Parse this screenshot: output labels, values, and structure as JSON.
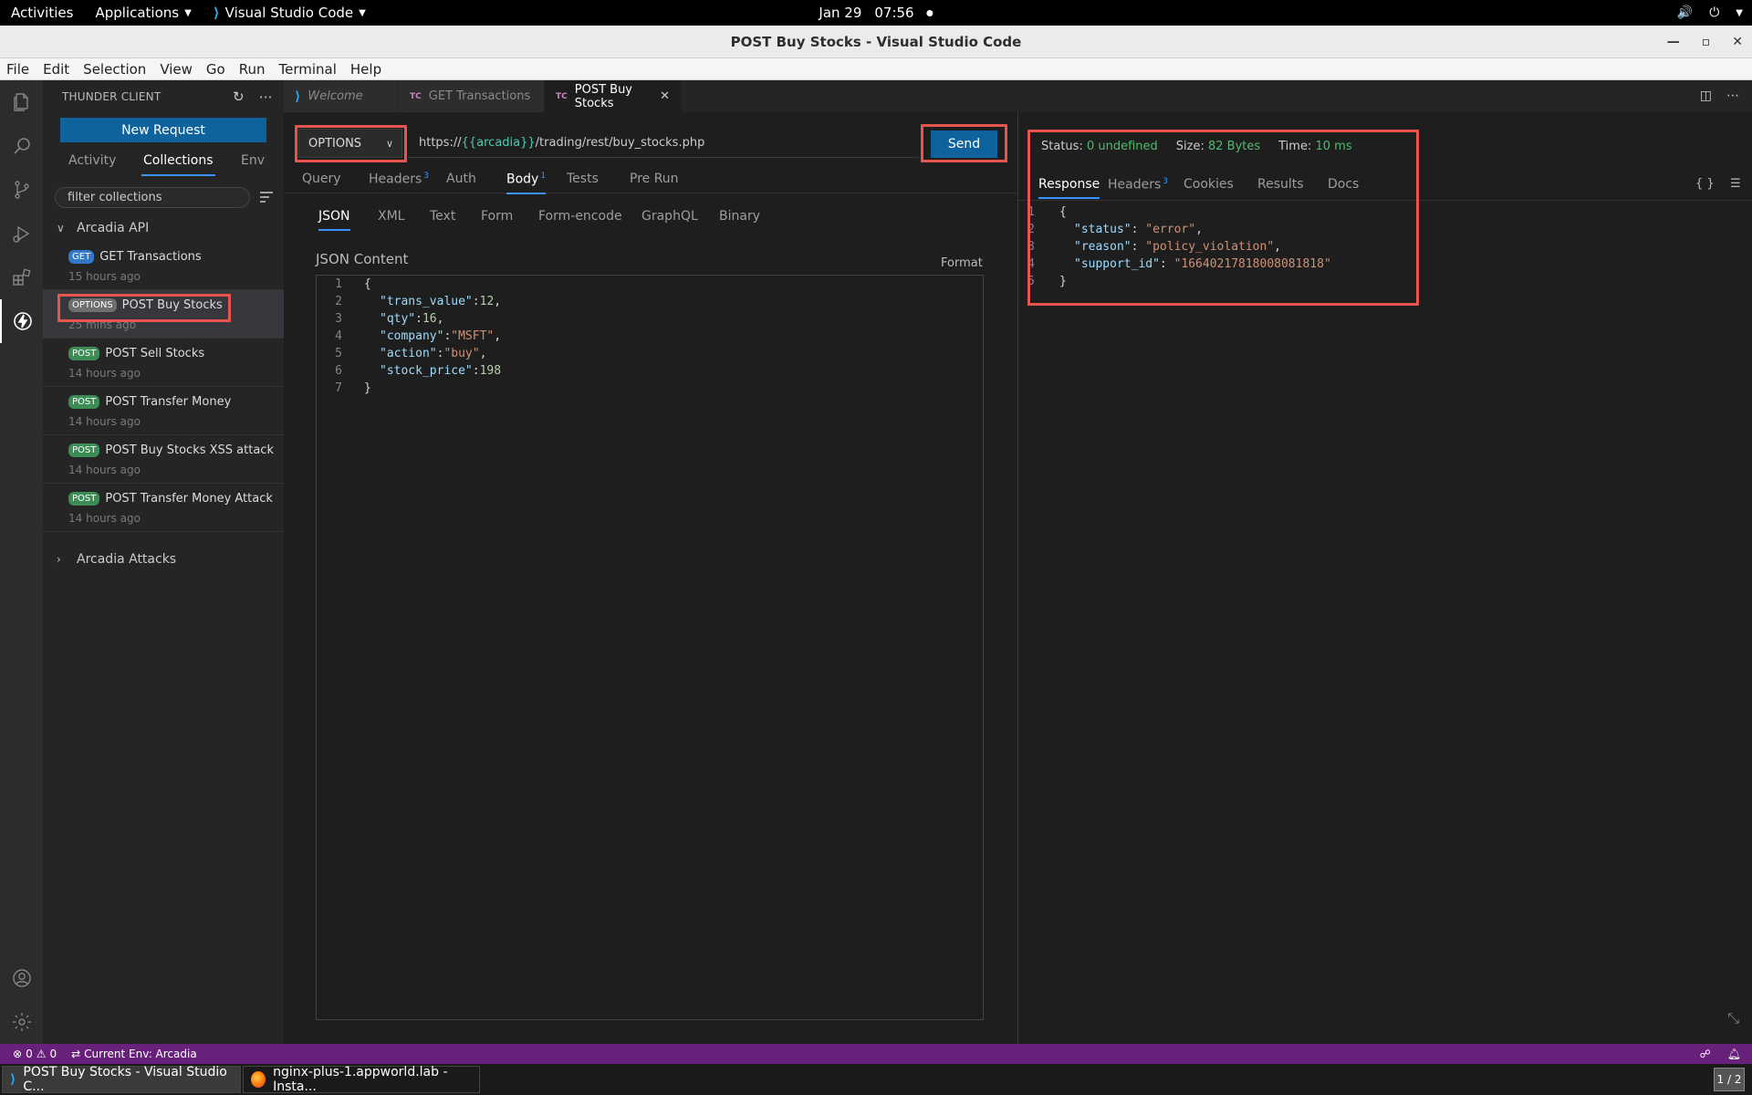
{
  "topbar": {
    "activities": "Activities",
    "applications": "Applications",
    "app_name": "Visual Studio Code",
    "date": "Jan 29",
    "time": "07:56"
  },
  "window": {
    "title": "POST Buy Stocks - Visual Studio Code"
  },
  "menu": [
    "File",
    "Edit",
    "Selection",
    "View",
    "Go",
    "Run",
    "Terminal",
    "Help"
  ],
  "sidebar": {
    "title": "THUNDER CLIENT",
    "new_request": "New Request",
    "tabs": [
      "Activity",
      "Collections",
      "Env"
    ],
    "active_tab": "Collections",
    "filter_placeholder": "filter collections",
    "collection": "Arcadia API",
    "requests": [
      {
        "method": "GET",
        "name": "GET Transactions",
        "time": "15 hours ago"
      },
      {
        "method": "OPTIONS",
        "name": "POST Buy Stocks",
        "time": "25 mins ago"
      },
      {
        "method": "POST",
        "name": "POST Sell Stocks",
        "time": "14 hours ago"
      },
      {
        "method": "POST",
        "name": "POST Transfer Money",
        "time": "14 hours ago"
      },
      {
        "method": "POST",
        "name": "POST Buy Stocks XSS attack",
        "time": "14 hours ago"
      },
      {
        "method": "POST",
        "name": "POST Transfer Money Attack",
        "time": "14 hours ago"
      }
    ],
    "collection2": "Arcadia Attacks"
  },
  "tabs": [
    {
      "label": "Welcome",
      "icon": "vscode-icon"
    },
    {
      "label": "GET Transactions",
      "icon": "TC"
    },
    {
      "label": "POST Buy Stocks",
      "icon": "TC"
    }
  ],
  "request": {
    "method": "OPTIONS",
    "url_prefix": "https://",
    "url_var": "{{arcadia}}",
    "url_path": "/trading/rest/buy_stocks.php",
    "send": "Send",
    "tabs": {
      "query": "Query",
      "headers": "Headers",
      "headers_count": "3",
      "auth": "Auth",
      "body": "Body",
      "body_count": "1",
      "tests": "Tests",
      "prerun": "Pre Run"
    },
    "body_types": [
      "JSON",
      "XML",
      "Text",
      "Form",
      "Form-encode",
      "GraphQL",
      "Binary"
    ],
    "content_label": "JSON Content",
    "format": "Format",
    "body_lines": [
      {
        "no": "1",
        "key": "",
        "val": "",
        "text": "{"
      },
      {
        "no": "2",
        "key": "\"trans_value\"",
        "val": "12",
        "type": "n"
      },
      {
        "no": "3",
        "key": "\"qty\"",
        "val": "16",
        "type": "n"
      },
      {
        "no": "4",
        "key": "\"company\"",
        "val": "\"MSFT\"",
        "type": "s"
      },
      {
        "no": "5",
        "key": "\"action\"",
        "val": "\"buy\"",
        "type": "s"
      },
      {
        "no": "6",
        "key": "\"stock_price\"",
        "val": "198",
        "type": "n"
      },
      {
        "no": "7",
        "key": "",
        "val": "",
        "text": "}"
      }
    ]
  },
  "response": {
    "status_label": "Status:",
    "status_value": "0 undefined",
    "size_label": "Size:",
    "size_value": "82 Bytes",
    "time_label": "Time:",
    "time_value": "10 ms",
    "tabs": {
      "response": "Response",
      "headers": "Headers",
      "headers_count": "3",
      "cookies": "Cookies",
      "results": "Results",
      "docs": "Docs"
    },
    "lines": [
      {
        "no": "1",
        "text": "{"
      },
      {
        "no": "2",
        "key": "\"status\"",
        "val": "\"error\"",
        "comma": ","
      },
      {
        "no": "3",
        "key": "\"reason\"",
        "val": "\"policy_violation\"",
        "comma": ","
      },
      {
        "no": "4",
        "key": "\"support_id\"",
        "val": "\"16640217818008081818\"",
        "comma": ""
      },
      {
        "no": "5",
        "text": "}"
      }
    ]
  },
  "statusbar": {
    "errors": "0",
    "warnings": "0",
    "env": "Current Env: Arcadia"
  },
  "taskbar": {
    "vscode": "POST Buy Stocks - Visual Studio C...",
    "firefox": "nginx-plus-1.appworld.lab - Insta...",
    "pager": "1 / 2"
  },
  "colors": {
    "accent": "#0e639c",
    "highlight": "#e8554e",
    "statusbar": "#68217a",
    "success": "#4fba6e"
  }
}
